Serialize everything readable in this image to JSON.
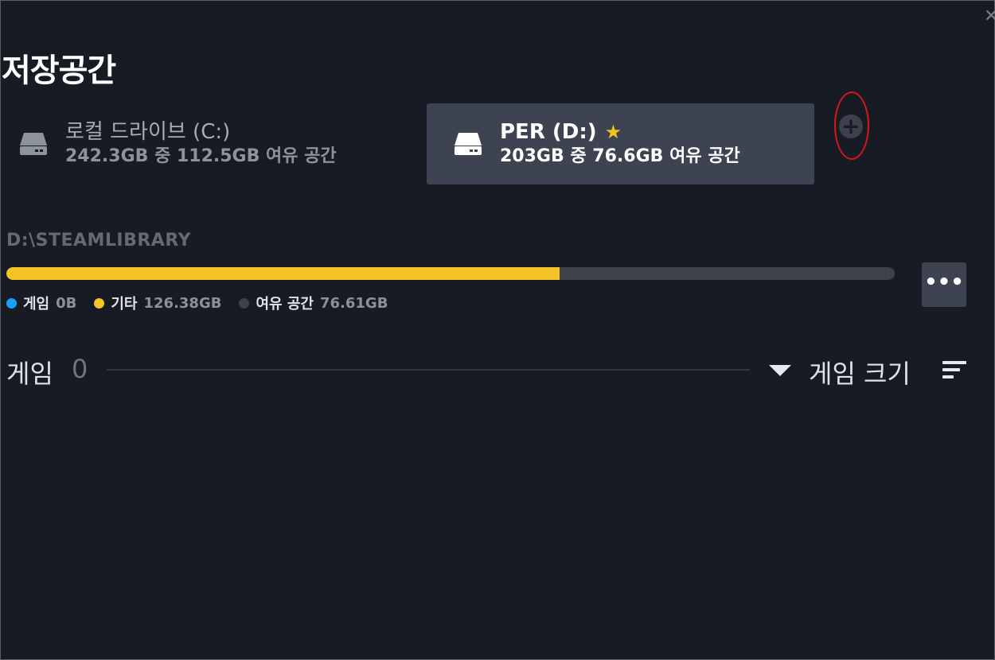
{
  "header": {
    "title": "저장공간",
    "close_glyph": "✕"
  },
  "drives": [
    {
      "name": "로컬 드라이브 (C:)",
      "space": "242.3GB 중 112.5GB 여유 공간",
      "icon": "hard-drive-icon",
      "selected": false,
      "favorite": false
    },
    {
      "name": "PER (D:)",
      "space": "203GB 중 76.6GB 여유 공간",
      "icon": "hard-drive-icon",
      "selected": true,
      "favorite": true,
      "favorite_glyph": "★"
    }
  ],
  "add_button": {
    "glyph": "+",
    "icon": "add-drive-icon"
  },
  "library": {
    "path": "D:\\STEAMLIBRARY",
    "usage_fraction_used": 0.623,
    "legend": [
      {
        "label": "게임",
        "value": "0B",
        "color": "#1a9fff"
      },
      {
        "label": "기타",
        "value": "126.38GB",
        "color": "#f4c426"
      },
      {
        "label": "여유 공간",
        "value": "76.61GB",
        "color": "#3d424c"
      }
    ],
    "more_glyph": "•••"
  },
  "games": {
    "label": "게임",
    "count": "0",
    "sort_label": "게임 크기",
    "sort_icon": "sort-lines-icon"
  },
  "colors": {
    "accent_yellow": "#f4c426",
    "annotation_red": "#d9161c",
    "selected_bg": "#3d4350"
  }
}
